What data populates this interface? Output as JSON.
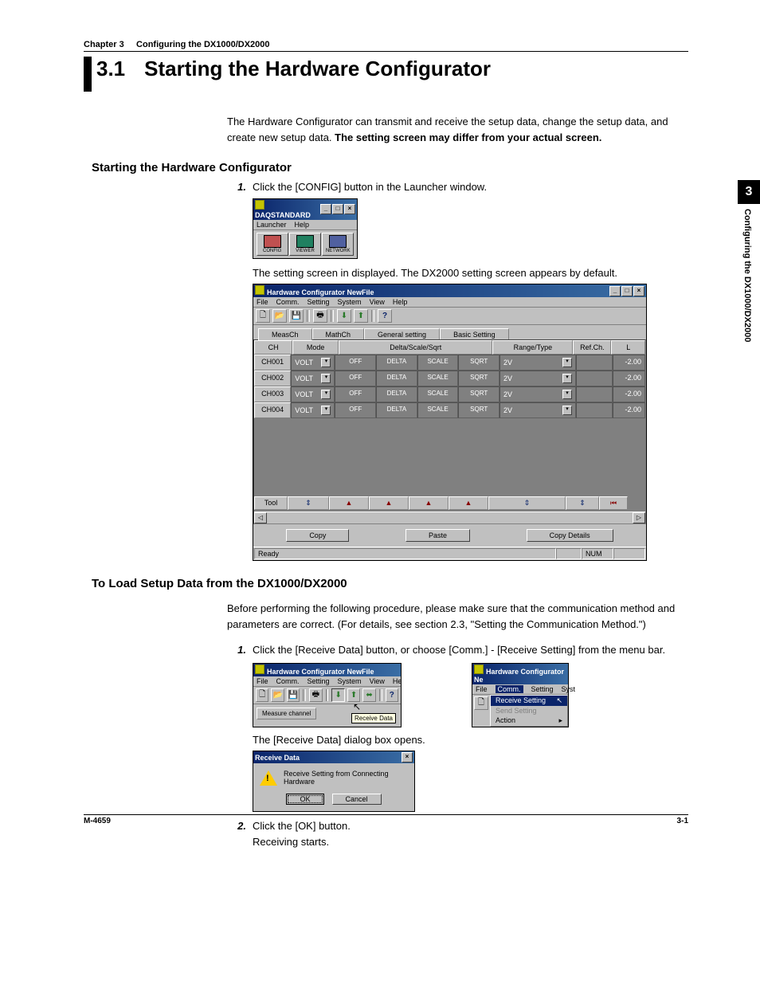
{
  "header": {
    "chapter": "Chapter 3",
    "chapter_title": "Configuring the DX1000/DX2000"
  },
  "title": {
    "section_no": "3.1",
    "section_title": "Starting the Hardware Configurator"
  },
  "intro": {
    "p1a": "The Hardware Configurator can transmit and receive the setup data, change the setup data, and create new setup data.  ",
    "p1b": "The setting screen may differ from your actual screen."
  },
  "h2_1": "Starting the Hardware Configurator",
  "step1": {
    "num": "1.",
    "text": "Click the [CONFIG] button in the Launcher window."
  },
  "launcher": {
    "title": "DAQSTANDARD",
    "menus": [
      "Launcher",
      "Help"
    ],
    "icons": [
      {
        "label": "CONFIG",
        "color": "#c05050"
      },
      {
        "label": "VIEWER",
        "color": "#208060"
      },
      {
        "label": "NETWORK",
        "color": "#5060a0"
      }
    ]
  },
  "caption1": "The setting screen in displayed. The DX2000 setting screen appears by default.",
  "mainwin": {
    "title": "Hardware Configurator NewFile",
    "menus": [
      "File",
      "Comm.",
      "Setting",
      "System",
      "View",
      "Help"
    ],
    "tabs": [
      "MeasCh",
      "MathCh",
      "General setting",
      "Basic Setting"
    ],
    "headers": {
      "ch": "CH",
      "mode": "Mode",
      "dss": "Delta/Scale/Sqrt",
      "range": "Range/Type",
      "refch": "Ref.Ch.",
      "l": "L"
    },
    "rows": [
      {
        "ch": "CH001",
        "mode": "VOLT",
        "off": "OFF",
        "b1": "DELTA",
        "b2": "SCALE",
        "b3": "SQRT",
        "range": "2V",
        "l": "-2.00"
      },
      {
        "ch": "CH002",
        "mode": "VOLT",
        "off": "OFF",
        "b1": "DELTA",
        "b2": "SCALE",
        "b3": "SQRT",
        "range": "2V",
        "l": "-2.00"
      },
      {
        "ch": "CH003",
        "mode": "VOLT",
        "off": "OFF",
        "b1": "DELTA",
        "b2": "SCALE",
        "b3": "SQRT",
        "range": "2V",
        "l": "-2.00"
      },
      {
        "ch": "CH004",
        "mode": "VOLT",
        "off": "OFF",
        "b1": "DELTA",
        "b2": "SCALE",
        "b3": "SQRT",
        "range": "2V",
        "l": "-2.00"
      }
    ],
    "toolrow_label": "Tool",
    "bottom_buttons": [
      "Copy",
      "Paste",
      "Copy Details"
    ],
    "status_ready": "Ready",
    "status_num": "NUM"
  },
  "h2_2": "To Load Setup Data from the DX1000/DX2000",
  "p2": "Before performing the following procedure, please make sure that the communication method and parameters are correct.  (For details, see section 2.3, \"Setting the Communication Method.\")",
  "step_r1": {
    "num": "1.",
    "text": "Click the [Receive Data] button, or choose [Comm.] - [Receive Setting] from the menu bar."
  },
  "toolshot": {
    "title": "Hardware Configurator NewFile",
    "menus": [
      "File",
      "Comm.",
      "Setting",
      "System",
      "View",
      "He"
    ],
    "tab": "Measure channel",
    "tooltip": "Receive Data"
  },
  "menushot": {
    "title": "Hardware Configurator Ne",
    "menus": [
      "File",
      "Comm.",
      "Setting",
      "Syst"
    ],
    "items": [
      {
        "label": "Receive Setting",
        "hl": true
      },
      {
        "label": "Send Setting",
        "dis": true
      },
      {
        "label": "Action",
        "arrow": true
      }
    ]
  },
  "caption2": "The [Receive Data] dialog box opens.",
  "dlg": {
    "title": "Receive Data",
    "msg": "Receive Setting from Connecting Hardware",
    "ok": "OK",
    "cancel": "Cancel"
  },
  "step_r2": {
    "num": "2.",
    "text1": "Click the [OK] button.",
    "text2": "Receiving starts."
  },
  "sidetab": {
    "num": "3",
    "text": "Configuring the DX1000/DX2000"
  },
  "footer": {
    "left": "M-4659",
    "right": "3-1"
  }
}
